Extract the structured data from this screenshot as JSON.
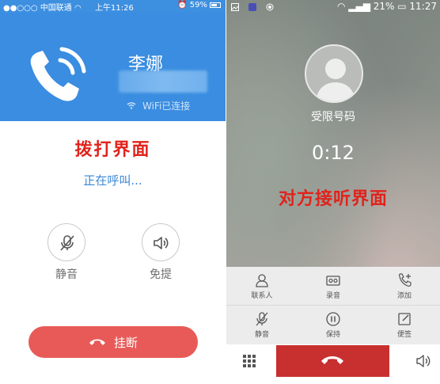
{
  "left": {
    "status": {
      "carrier": "中国联通",
      "time": "上午11:26",
      "battery": "59%"
    },
    "contact_name": "李娜",
    "wifi_status": "WiFi已连接",
    "caption": "拨打界面",
    "calling_text": "正在呼叫...",
    "mute_label": "静音",
    "speaker_label": "免提",
    "hangup_label": "挂断"
  },
  "right": {
    "status": {
      "battery": "21%",
      "time": "11:27"
    },
    "caller_label": "受限号码",
    "timer": "0:12",
    "caption": "对方接听界面",
    "grid": [
      {
        "icon": "contact-icon",
        "label": "联系人"
      },
      {
        "icon": "record-icon",
        "label": "录音"
      },
      {
        "icon": "add-call-icon",
        "label": "添加"
      },
      {
        "icon": "mute-icon",
        "label": "静音"
      },
      {
        "icon": "hold-icon",
        "label": "保持"
      },
      {
        "icon": "note-icon",
        "label": "便签"
      }
    ]
  },
  "colors": {
    "accent_blue": "#3a8de0",
    "caption_red": "#e0231c",
    "hangup_red": "#e85a57",
    "end_call_red": "#c7302f"
  }
}
